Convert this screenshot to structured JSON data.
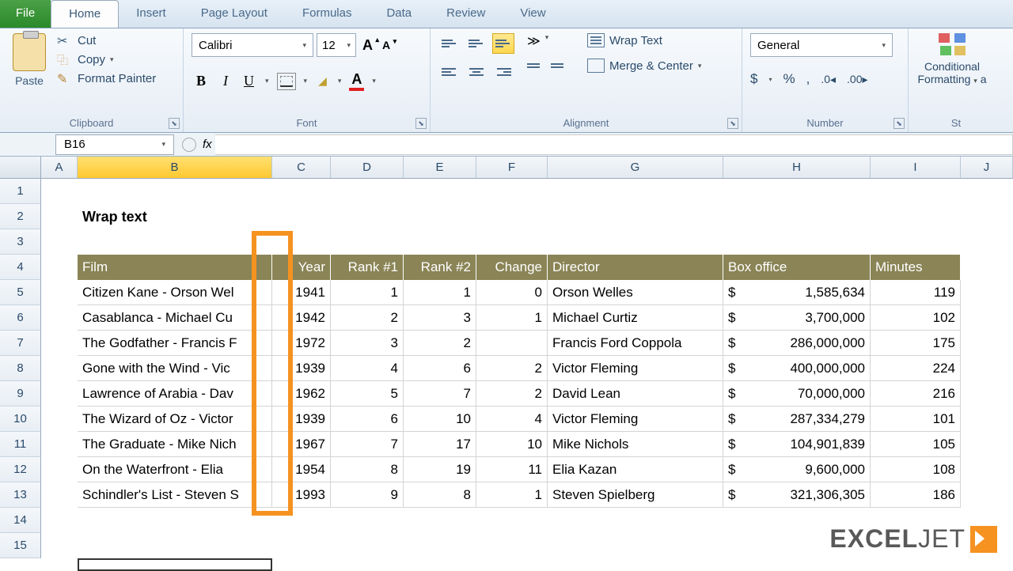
{
  "tabs": {
    "file": "File",
    "home": "Home",
    "insert": "Insert",
    "pagelayout": "Page Layout",
    "formulas": "Formulas",
    "data": "Data",
    "review": "Review",
    "view": "View"
  },
  "clipboard": {
    "paste": "Paste",
    "cut": "Cut",
    "copy": "Copy",
    "painter": "Format Painter",
    "label": "Clipboard"
  },
  "font": {
    "name": "Calibri",
    "size": "12",
    "label": "Font"
  },
  "alignment": {
    "wrap": "Wrap Text",
    "merge": "Merge & Center",
    "label": "Alignment"
  },
  "number": {
    "format": "General",
    "label": "Number"
  },
  "styles": {
    "cond": "Conditional Formatting",
    "label": "St"
  },
  "namebox": "B16",
  "title": "Wrap text",
  "headers": {
    "film": "Film",
    "year": "Year",
    "rank1": "Rank #1",
    "rank2": "Rank #2",
    "change": "Change",
    "director": "Director",
    "box": "Box office",
    "min": "Minutes"
  },
  "cols": [
    "A",
    "B",
    "C",
    "D",
    "E",
    "F",
    "G",
    "H",
    "I",
    "J"
  ],
  "rows": [
    {
      "film": "Citizen Kane - Orson Wel",
      "year": "1941",
      "r1": "1",
      "r2": "1",
      "chg": "0",
      "dir": "Orson Welles",
      "box": "1,585,634",
      "min": "119"
    },
    {
      "film": "Casablanca - Michael Cu",
      "year": "1942",
      "r1": "2",
      "r2": "3",
      "chg": "1",
      "dir": "Michael Curtiz",
      "box": "3,700,000",
      "min": "102"
    },
    {
      "film": "The Godfather - Francis F",
      "year": "1972",
      "r1": "3",
      "r2": "2",
      "chg": "",
      "dir": "Francis Ford Coppola",
      "box": "286,000,000",
      "min": "175"
    },
    {
      "film": "Gone with the Wind - Vic",
      "year": "1939",
      "r1": "4",
      "r2": "6",
      "chg": "2",
      "dir": "Victor Fleming",
      "box": "400,000,000",
      "min": "224"
    },
    {
      "film": "Lawrence of Arabia - Dav",
      "year": "1962",
      "r1": "5",
      "r2": "7",
      "chg": "2",
      "dir": "David Lean",
      "box": "70,000,000",
      "min": "216"
    },
    {
      "film": "The Wizard of Oz - Victor",
      "year": "1939",
      "r1": "6",
      "r2": "10",
      "chg": "4",
      "dir": "Victor Fleming",
      "box": "287,334,279",
      "min": "101"
    },
    {
      "film": "The Graduate - Mike Nich",
      "year": "1967",
      "r1": "7",
      "r2": "17",
      "chg": "10",
      "dir": "Mike Nichols",
      "box": "104,901,839",
      "min": "105"
    },
    {
      "film": "On the Waterfront - Elia",
      "year": "1954",
      "r1": "8",
      "r2": "19",
      "chg": "11",
      "dir": "Elia Kazan",
      "box": "9,600,000",
      "min": "108"
    },
    {
      "film": "Schindler's List - Steven S",
      "year": "1993",
      "r1": "9",
      "r2": "8",
      "chg": "1",
      "dir": "Steven Spielberg",
      "box": "321,306,305",
      "min": "186"
    }
  ],
  "logo": {
    "a": "EXCEL",
    "b": "JET"
  },
  "currency": "$"
}
